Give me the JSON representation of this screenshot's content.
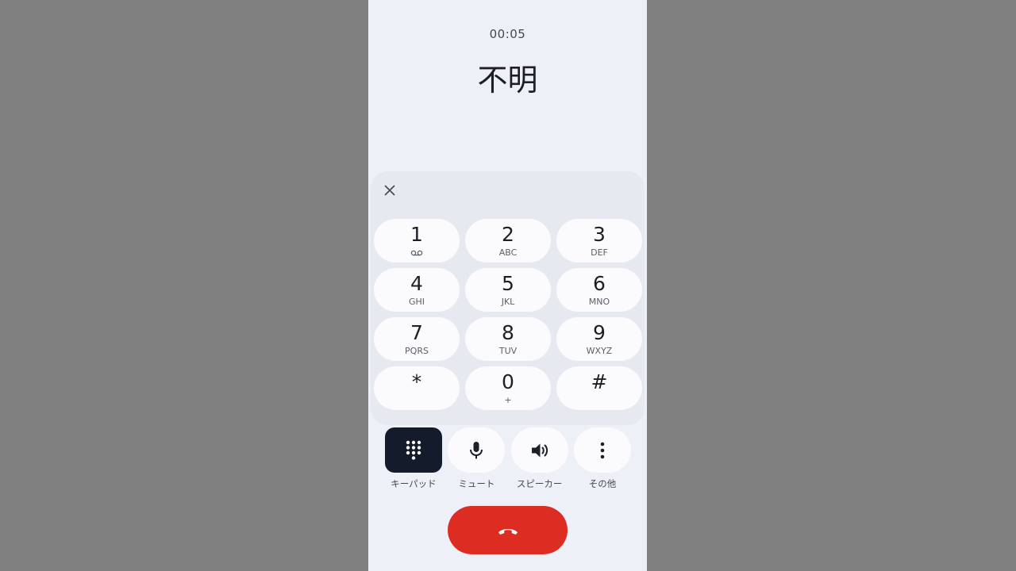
{
  "call": {
    "timer": "00:05",
    "caller": "不明"
  },
  "keypad": {
    "close_icon": "close-icon",
    "keys": [
      {
        "digit": "1",
        "sub": "",
        "sub_icon": "voicemail-icon"
      },
      {
        "digit": "2",
        "sub": "ABC"
      },
      {
        "digit": "3",
        "sub": "DEF"
      },
      {
        "digit": "4",
        "sub": "GHI"
      },
      {
        "digit": "5",
        "sub": "JKL"
      },
      {
        "digit": "6",
        "sub": "MNO"
      },
      {
        "digit": "7",
        "sub": "PQRS"
      },
      {
        "digit": "8",
        "sub": "TUV"
      },
      {
        "digit": "9",
        "sub": "WXYZ"
      },
      {
        "digit": "*",
        "sub": ""
      },
      {
        "digit": "0",
        "sub": "+"
      },
      {
        "digit": "#",
        "sub": ""
      }
    ]
  },
  "controls": {
    "keypad_label": "キーパッド",
    "mute_label": "ミュート",
    "speaker_label": "スピーカー",
    "more_label": "その他"
  },
  "colors": {
    "end_call": "#dd2c21",
    "active_control": "#141c2c",
    "screen_bg": "#eef0f7",
    "key_bg": "#fbfbfe"
  }
}
